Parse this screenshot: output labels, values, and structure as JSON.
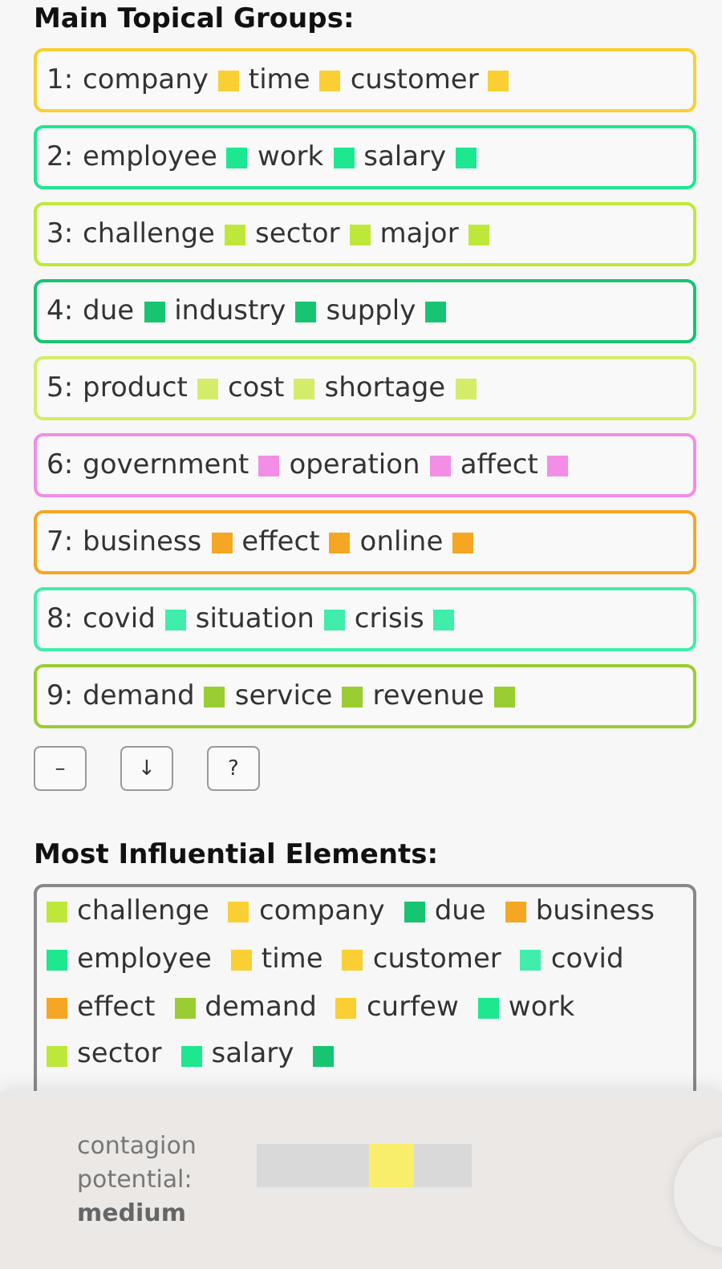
{
  "groups_title": "Main Topical Groups:",
  "groups": [
    {
      "number": "1:",
      "color": "#f9cf33",
      "words": [
        "company",
        "time",
        "customer"
      ]
    },
    {
      "number": "2:",
      "color": "#1de88f",
      "words": [
        "employee",
        "work",
        "salary"
      ]
    },
    {
      "number": "3:",
      "color": "#bde83a",
      "words": [
        "challenge",
        "sector",
        "major"
      ]
    },
    {
      "number": "4:",
      "color": "#17c472",
      "words": [
        "due",
        "industry",
        "supply"
      ]
    },
    {
      "number": "5:",
      "color": "#d3ed6a",
      "words": [
        "product",
        "cost",
        "shortage"
      ]
    },
    {
      "number": "6:",
      "color": "#f28ee5",
      "words": [
        "government",
        "operation",
        "affect"
      ]
    },
    {
      "number": "7:",
      "color": "#f5a623",
      "words": [
        "business",
        "effect",
        "online"
      ]
    },
    {
      "number": "8:",
      "color": "#40edab",
      "words": [
        "covid",
        "situation",
        "crisis"
      ]
    },
    {
      "number": "9:",
      "color": "#9acd32",
      "words": [
        "demand",
        "service",
        "revenue"
      ]
    }
  ],
  "buttons": [
    "–",
    "↓",
    "?"
  ],
  "elements_title": "Most Influential Elements:",
  "elements": [
    {
      "word": "challenge",
      "color": "#bde83a"
    },
    {
      "word": "company",
      "color": "#f9cf33"
    },
    {
      "word": "due",
      "color": "#17c472"
    },
    {
      "word": "business",
      "color": "#f5a623"
    },
    {
      "word": "employee",
      "color": "#1de88f"
    },
    {
      "word": "time",
      "color": "#f9cf33"
    },
    {
      "word": "customer",
      "color": "#f9cf33"
    },
    {
      "word": "covid",
      "color": "#40edab"
    },
    {
      "word": "effect",
      "color": "#f5a623"
    },
    {
      "word": "demand",
      "color": "#9acd32"
    },
    {
      "word": "curfew",
      "color": "#f9cf33"
    },
    {
      "word": "work",
      "color": "#1de88f"
    },
    {
      "word": "sector",
      "color": "#bde83a"
    },
    {
      "word": "salary",
      "color": "#1de88f"
    },
    {
      "color": "#17c472"
    }
  ],
  "contagion": {
    "label": "contagion potential:",
    "value": "medium",
    "level": 0.63
  }
}
